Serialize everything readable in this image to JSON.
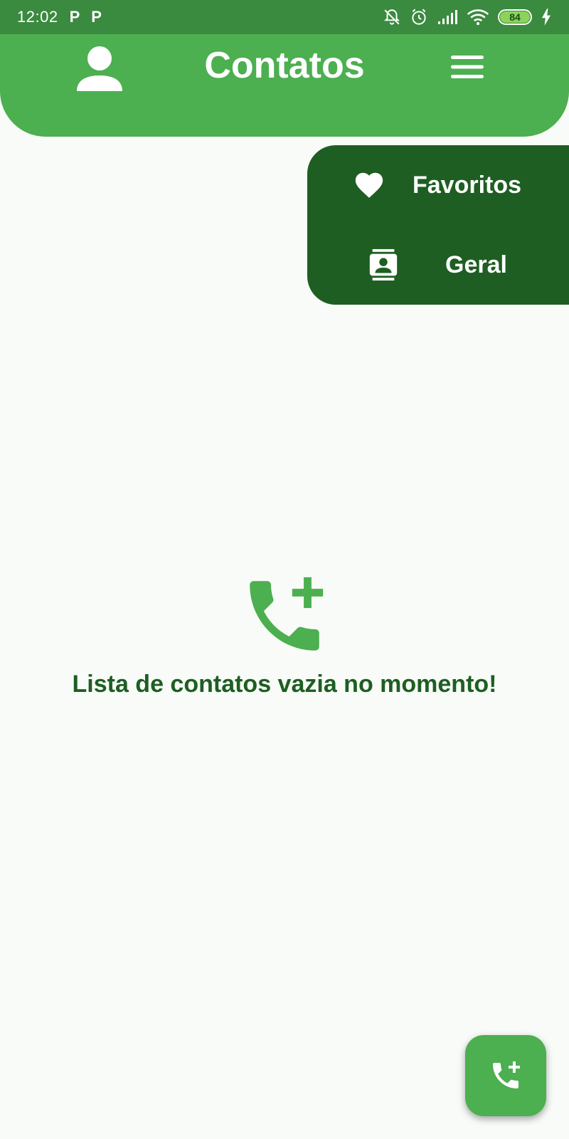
{
  "status_bar": {
    "time": "12:02",
    "notification_icons": [
      "P",
      "P"
    ],
    "battery_level": "84",
    "icons": [
      "mute-bell-icon",
      "alarm-icon",
      "signal-icon",
      "wifi-icon",
      "battery-icon",
      "charging-icon"
    ]
  },
  "header": {
    "title": "Contatos",
    "left_icon": "person-icon",
    "right_icon": "menu-icon",
    "color": "#4caf50"
  },
  "dropdown": {
    "color": "#1e5e22",
    "items": [
      {
        "label": "Favoritos",
        "icon": "heart-icon"
      },
      {
        "label": "Geral",
        "icon": "contacts-icon"
      }
    ]
  },
  "empty_state": {
    "icon": "add-call-icon",
    "message": "Lista de contatos vazia no momento!"
  },
  "fab": {
    "icon": "add-call-icon"
  },
  "colors": {
    "primary": "#4caf50",
    "primary_dark": "#1e5e22",
    "status_bar": "#3a8a3f",
    "background": "#f8fbf7"
  }
}
